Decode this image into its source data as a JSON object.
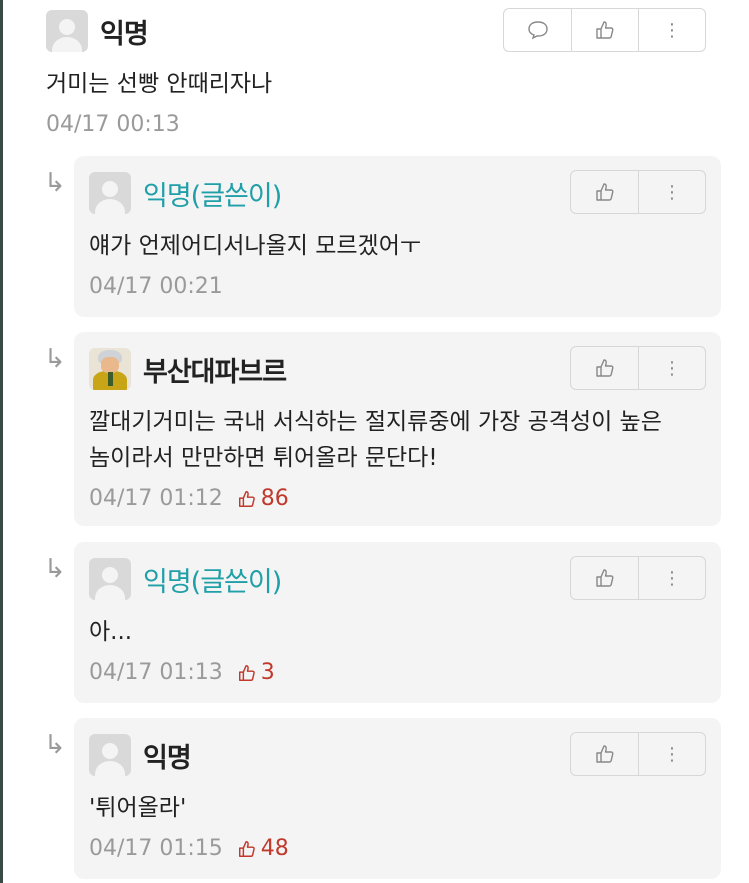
{
  "comments": [
    {
      "name": "익명",
      "text": "거미는 선빵 안때리자나",
      "time": "04/17 00:13"
    }
  ],
  "replies": [
    {
      "name": "익명(글쓴이)",
      "text": "얘가 언제어디서나올지 모르겠어ㅜ",
      "time": "04/17 00:21",
      "likes": ""
    },
    {
      "name": "부산대파브르",
      "text_line1": "깔대기거미는 국내 서식하는 절지류중에 가장 공격성이 높은",
      "text_line2": "놈이라서 만만하면 튀어올라 문단다!",
      "time": "04/17 01:12",
      "likes": "86"
    },
    {
      "name": "익명(글쓴이)",
      "text": "아...",
      "time": "04/17 01:13",
      "likes": "3"
    },
    {
      "name": "익명",
      "text": "'튀어올라'",
      "time": "04/17 01:15",
      "likes": "48"
    }
  ],
  "icons": {
    "reply_arrow": "↳",
    "more": "⋮",
    "accent_author": "#1f9fa8",
    "like_color": "#c0392b"
  }
}
